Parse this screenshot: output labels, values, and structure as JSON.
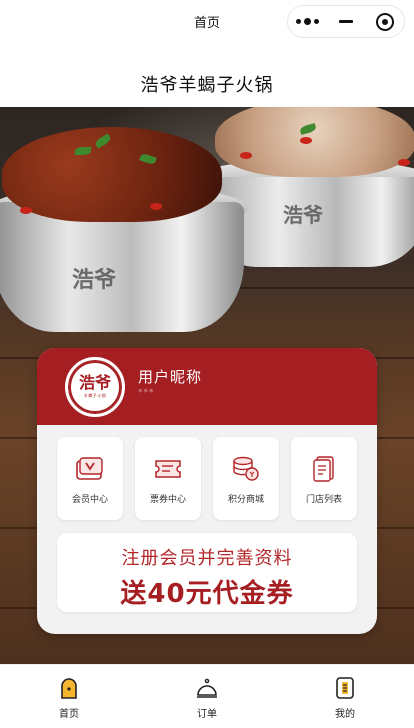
{
  "nav": {
    "title": "首页",
    "capsule_icons": [
      "more-dots-icon",
      "minimize-icon",
      "close-target-icon"
    ]
  },
  "store_title": "浩爷羊蝎子火锅",
  "hero": {
    "pot_mark": "浩爷"
  },
  "member": {
    "logo_mark": "浩爷",
    "logo_sub": "羊蝎子火锅",
    "nickname": "用户昵称",
    "sub_text": "***"
  },
  "menu": [
    {
      "label": "会员中心",
      "icon": "member-card-icon"
    },
    {
      "label": "票券中心",
      "icon": "ticket-icon"
    },
    {
      "label": "积分商城",
      "icon": "points-coins-icon"
    },
    {
      "label": "门店列表",
      "icon": "store-list-icon"
    }
  ],
  "promo": {
    "line1": "注册会员并完善资料",
    "line2": "送40元代金券"
  },
  "tabs": [
    {
      "label": "首页",
      "icon": "home-icon",
      "active": true
    },
    {
      "label": "订单",
      "icon": "order-bell-icon",
      "active": false
    },
    {
      "label": "我的",
      "icon": "profile-doc-icon",
      "active": false
    }
  ],
  "colors": {
    "brand_red": "#a41e22",
    "accent_yellow": "#f5b52e",
    "card_bg": "#f2f2f2"
  }
}
